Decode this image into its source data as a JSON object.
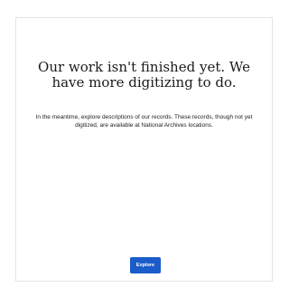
{
  "message": {
    "heading": "Our work isn't finished yet. We have more digitizing to do.",
    "body": "In the meantime, explore descriptions of our records. These records, though not yet digitized, are available at National Archives locations."
  },
  "actions": {
    "explore_label": "Explore"
  },
  "colors": {
    "button_background": "#1a5cc9",
    "card_border": "#e3e3e3"
  }
}
